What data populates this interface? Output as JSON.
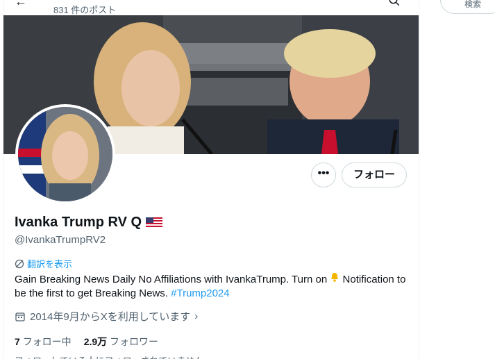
{
  "header": {
    "post_count": "831 件のポスト"
  },
  "profile": {
    "display_name": "Ivanka Trump RV Q",
    "handle": "@IvankaTrumpRV2",
    "translate_label": "翻訳を表示",
    "bio_before_bell": "Gain Breaking News Daily No Affiliations with IvankaTrump. Turn on",
    "bio_after_bell": "Notification to be the first to get Breaking News.",
    "hashtag": "#Trump2024",
    "joined": "2014年9月からXを利用しています",
    "following_count": "7",
    "following_label": "フォロー中",
    "followers_count": "2.9万",
    "followers_label": "フォロワー",
    "followed_by_note": "フォローしている人にフォローされていません"
  },
  "actions": {
    "more_label": "•••",
    "follow_label": "フォロー"
  },
  "sidebar": {
    "search_placeholder": "検索"
  },
  "colors": {
    "accent": "#1d9bf0",
    "text": "#0f1419",
    "muted": "#536471"
  }
}
